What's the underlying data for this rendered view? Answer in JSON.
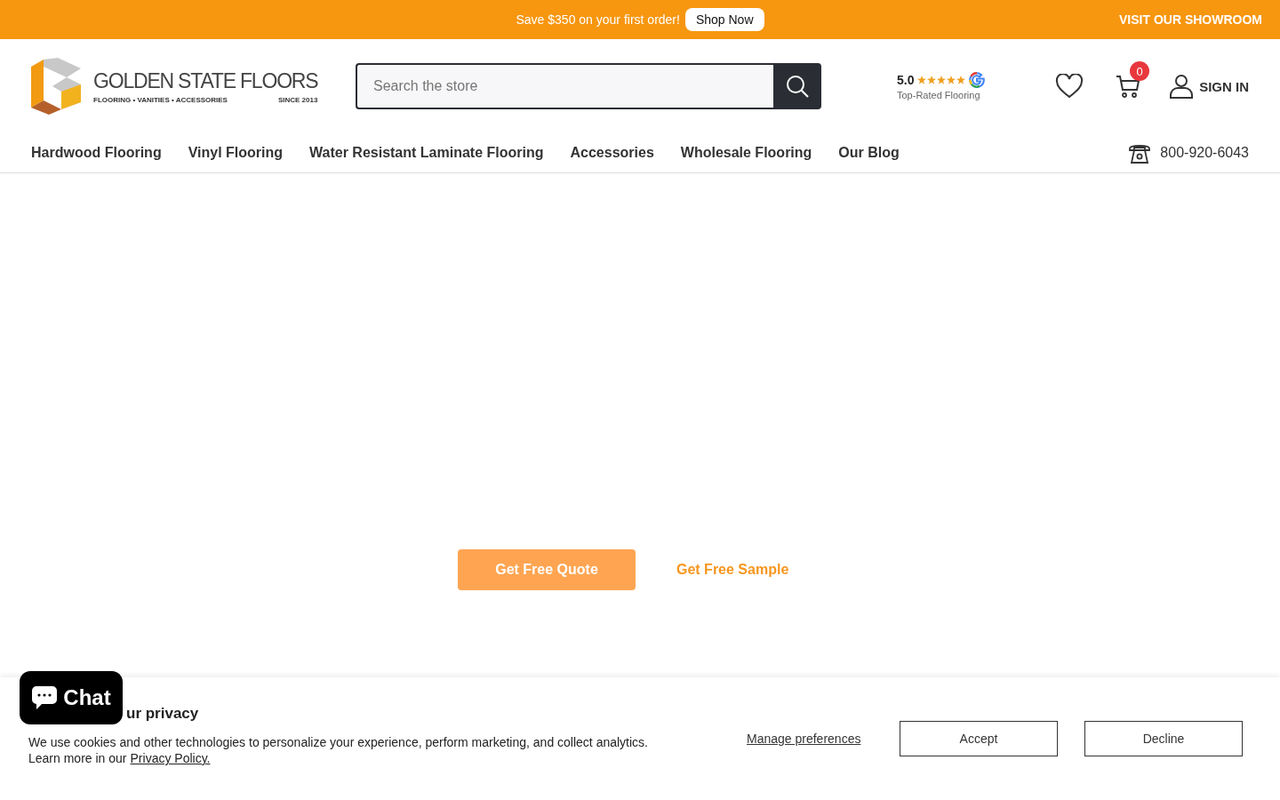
{
  "promo_bar": {
    "message": "Save $350 on your first order!",
    "button": "Shop Now",
    "showroom_link": "VISIT OUR SHOWROOM"
  },
  "header": {
    "logo": {
      "name": "GOLDEN STATE FLOORS",
      "tagline": "FLOORING • VANITIES • ACCESSORIES",
      "since": "SINCE 2013"
    },
    "search": {
      "placeholder": "Search the store"
    },
    "rating": {
      "score": "5.0",
      "stars": 5,
      "caption": "Top-Rated Flooring"
    },
    "cart_count": "0",
    "sign_in": "SIGN IN"
  },
  "nav": {
    "items": [
      "Hardwood Flooring",
      "Vinyl Flooring",
      "Water Resistant Laminate Flooring",
      "Accessories",
      "Wholesale Flooring",
      "Our Blog"
    ],
    "phone": "800-920-6043"
  },
  "actions": {
    "quote_button": "Get Free Quote",
    "sample_link": "Get Free Sample"
  },
  "chat_button": "Chat",
  "cookie_banner": {
    "title": "ur privacy",
    "text": "We use cookies and other technologies to personalize your experience, perform marketing, and collect analytics.",
    "learn_more": "Learn more in our",
    "policy_link": "Privacy Policy.",
    "manage": "Manage preferences",
    "accept": "Accept",
    "decline": "Decline"
  }
}
